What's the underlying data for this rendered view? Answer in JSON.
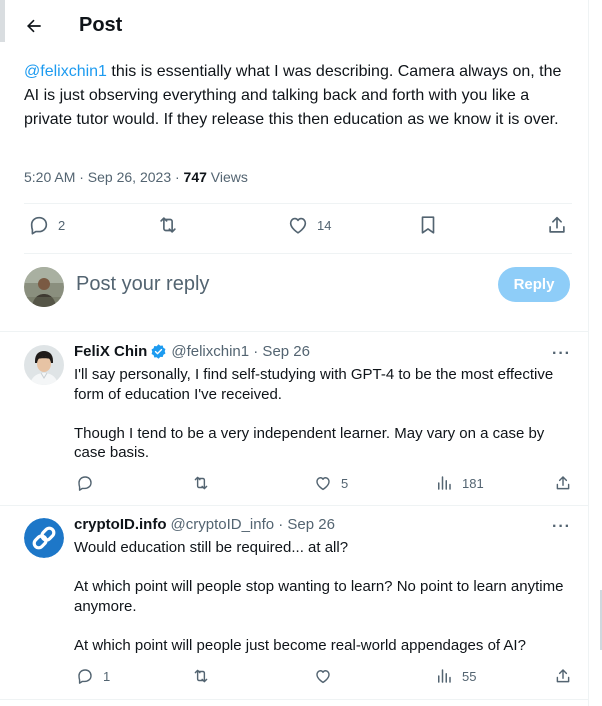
{
  "header": {
    "title": "Post"
  },
  "post": {
    "mention": "@felixchin1",
    "text": " this is essentially what I was describing. Camera always on, the AI is just observing everything and talking back and forth with you like a private tutor would. If they release this then education as we know it is over.",
    "time": "5:20 AM · Sep 26, 2023 · ",
    "views_count": "747",
    "views_label": " Views",
    "actions": {
      "replies": "2",
      "likes": "14"
    }
  },
  "reply_composer": {
    "placeholder": "Post your reply",
    "button": "Reply"
  },
  "replies": [
    {
      "name": "FeliX Chin",
      "verified": true,
      "handle": "@felixchin1 · Sep 26",
      "paragraphs": [
        "I'll say personally, I find self-studying with GPT-4 to be the most effective form of education I've received.",
        "Though I tend to be a very independent learner. May vary on a case by case basis."
      ],
      "more": "···",
      "actions": {
        "replies": "",
        "reposts": "",
        "likes": "5",
        "views": "181"
      }
    },
    {
      "name": "cryptoID.info",
      "verified": false,
      "handle": "@cryptoID_info · Sep 26",
      "paragraphs": [
        "Would education still be required... at all?",
        "At which point will people stop wanting to learn? No point to learn anytime anymore.",
        "At which point will people just become real-world appendages of AI?"
      ],
      "more": "···",
      "actions": {
        "replies": "1",
        "reposts": "",
        "likes": "",
        "views": "55"
      }
    }
  ],
  "colors": {
    "accent": "#1d9bf0",
    "muted": "#536471",
    "text": "#0f1419",
    "reply_button": "#8ecdf8",
    "border": "#eff3f4"
  }
}
